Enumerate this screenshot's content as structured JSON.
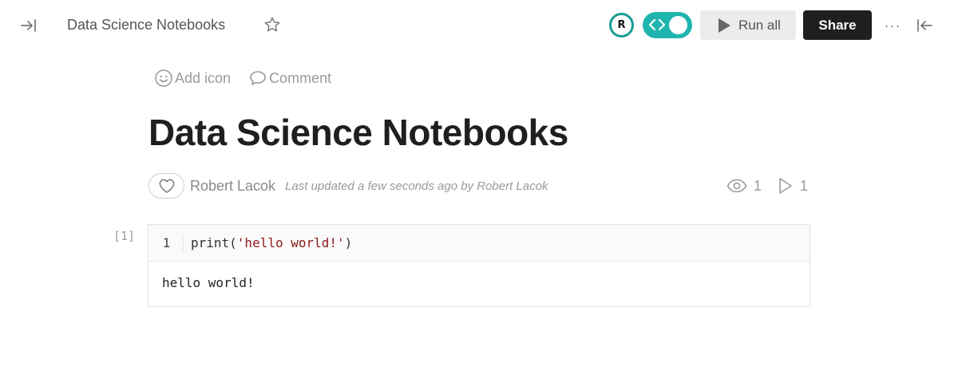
{
  "topbar": {
    "title": "Data Science Notebooks",
    "avatar_initial": "R",
    "run_all_label": "Run all",
    "share_label": "Share",
    "more_label": "···"
  },
  "doc": {
    "actions": {
      "add_icon_label": "Add icon",
      "comment_label": "Comment"
    },
    "title": "Data Science Notebooks",
    "author": "Robert Lacok",
    "updated": "Last updated a few seconds ago by Robert Lacok",
    "views": "1",
    "runs": "1"
  },
  "cell": {
    "exec_count": "[1]",
    "line_number": "1",
    "code_fn": "print(",
    "code_str": "'hello world!'",
    "code_close": ")",
    "output": "hello world!"
  },
  "colors": {
    "accent": "#1fb5ae",
    "share_bg": "#1f1f1f",
    "string": "#8b1a1a"
  }
}
